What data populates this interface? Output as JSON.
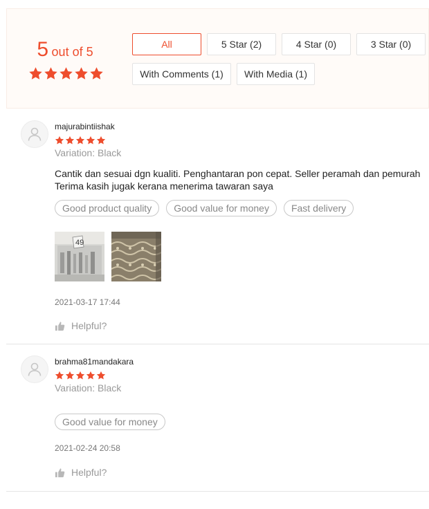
{
  "summary": {
    "score": "5",
    "score_suffix": "out of 5",
    "rating_stars": 5,
    "filters": {
      "all": "All",
      "five_star": "5 Star (2)",
      "four_star": "4 Star (0)",
      "three_star": "3 Star (0)",
      "with_comments": "With Comments (1)",
      "with_media": "With Media (1)"
    }
  },
  "colors": {
    "accent": "#ee4d2d",
    "summary_background": "#fffbf8",
    "muted_text": "#999999"
  },
  "reviews": [
    {
      "author": "majurabintiishak",
      "rating": 5,
      "variation": "Variation: Black",
      "comment": "Cantik dan sesuai dgn kualiti. Penghantaran pon cepat. Seller peramah dan pemurah  Terima kasih jugak kerana menerima tawaran saya",
      "tags": [
        "Good product quality",
        "Good value for money",
        "Fast delivery"
      ],
      "media_count": 2,
      "timestamp": "2021-03-17 17:44",
      "helpful_label": "Helpful?"
    },
    {
      "author": "brahma81mandakara",
      "rating": 5,
      "variation": "Variation: Black",
      "tags": [
        "Good value for money"
      ],
      "timestamp": "2021-02-24 20:58",
      "helpful_label": "Helpful?"
    }
  ],
  "icons": {
    "star": "star-icon",
    "avatar": "user-avatar-icon",
    "helpful": "thumbs-up-icon"
  }
}
